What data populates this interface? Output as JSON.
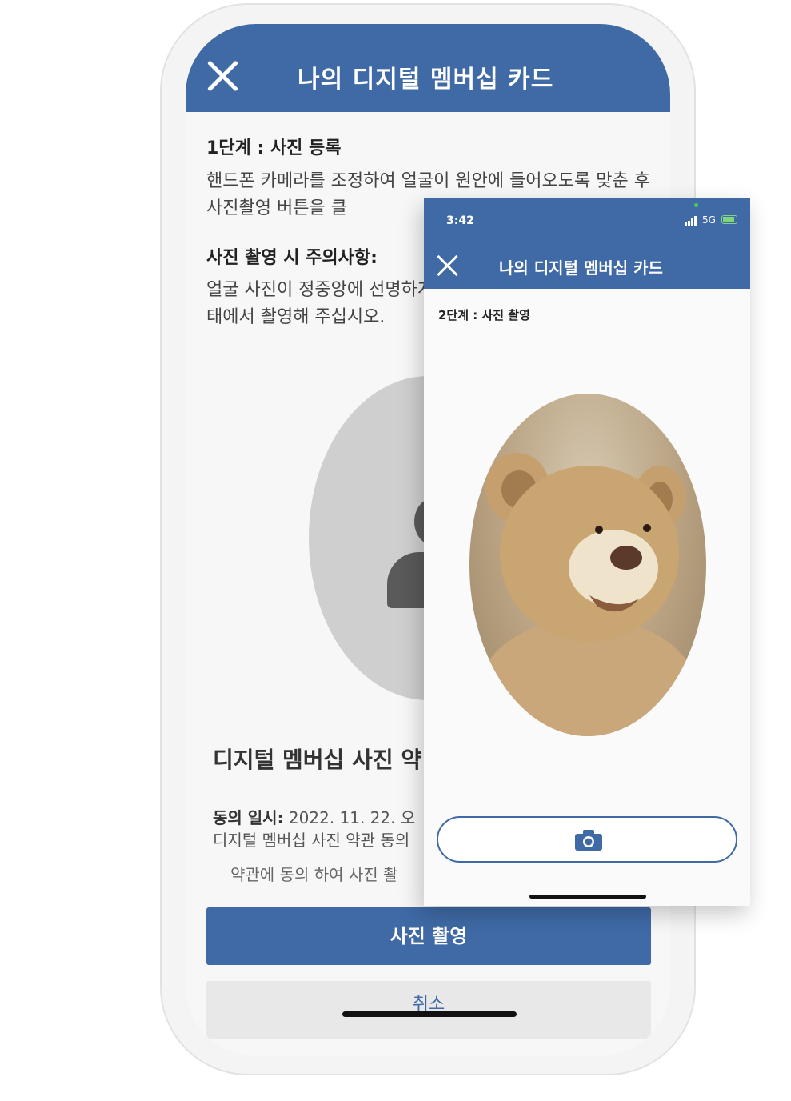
{
  "back_screen": {
    "header_title": "나의 디지털 멤버십 카드",
    "step_title": "1단계 : 사진 등록",
    "step_description": "핸드폰 카메라를 조정하여 얼굴이 원안에 들어오도록 맞춘 후 사진촬영 버튼을 클",
    "notice_title": "사진 촬영 시 주의사항:",
    "notice_description": "얼굴 사진이 정중앙에 선명하게 초점을 맞추어 주시고 모자 태에서 촬영해 주십시오.",
    "consent_title": "디지털 멤버십 사진 약",
    "consent_date_label": "동의 일시:",
    "consent_date_value": "2022. 11. 22. 오",
    "consent_text": "디지털 멤버십 사진 약관 동의",
    "consent_note": "약관에 동의 하여 사진 촬",
    "photo_button": "사진 촬영",
    "cancel_button": "취소"
  },
  "front_screen": {
    "status_time": "3:42",
    "status_network": "5G",
    "header_title": "나의 디지털 멤버십 카드",
    "step_title": "2단계 : 사진 촬영"
  },
  "colors": {
    "brand": "#3f6aa6",
    "background": "#f7f7f7"
  },
  "icons": {
    "close": "close-icon",
    "camera": "camera-icon",
    "placeholder": "user-silhouette-icon"
  }
}
